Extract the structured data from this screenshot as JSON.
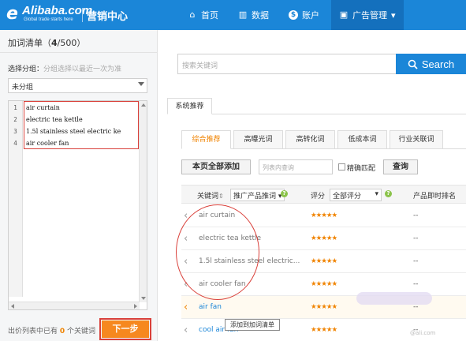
{
  "header": {
    "logo_mark": "e",
    "logo_text": "Alibaba.com",
    "logo_tagline": "Global trade starts here",
    "title": "营销中心",
    "nav": [
      {
        "label": "首页",
        "icon": "home-icon",
        "glyph": "⌂"
      },
      {
        "label": "数据",
        "icon": "bar-chart-icon",
        "glyph": "▥"
      },
      {
        "label": "账户",
        "icon": "dollar-circle-icon",
        "glyph": "$"
      },
      {
        "label": "广告管理",
        "icon": "briefcase-icon",
        "glyph": "▣",
        "caret": "▾"
      }
    ]
  },
  "left_panel": {
    "title_prefix": "加词清单（",
    "count": "4",
    "title_suffix": "/500）",
    "group_label": "选择分组：",
    "group_hint": "分组选择以最近一次为准",
    "group_value": "未分组",
    "lines": [
      "1",
      "2",
      "3",
      "4"
    ],
    "keywords": [
      "air curtain",
      "electric tea kettle",
      "1.5l stainless steel electric ke",
      "air cooler fan"
    ],
    "count_prefix": "出价列表中已有",
    "count_value": "0",
    "count_suffix": "个关键词",
    "next_button": "下一步"
  },
  "right_panel": {
    "search_placeholder": "搜索关键词",
    "search_button": "Search",
    "tab_label": "系统推荐",
    "subtabs": [
      "综合推荐",
      "高曝光词",
      "高转化词",
      "低成本词",
      "行业关联词"
    ],
    "add_all_button": "本页全部添加",
    "inner_search_placeholder": "列表内查询",
    "exact_label": "精确匹配",
    "query_button": "查询",
    "table": {
      "col_keyword": "关键词",
      "sort_glyph": "⇕",
      "col_promo": "推广产品推词",
      "col_score": "评分",
      "score_filter": "全部评分",
      "col_rank": "产品即时排名",
      "rows": [
        {
          "keyword": "air curtain",
          "stars": "★★★★★",
          "rank": "--"
        },
        {
          "keyword": "electric tea kettle",
          "stars": "★★★★★",
          "rank": "--"
        },
        {
          "keyword": "1.5l stainless steel electric...",
          "stars": "★★★★★",
          "rank": "--"
        },
        {
          "keyword": "air cooler fan",
          "stars": "★★★★★",
          "rank": "--"
        },
        {
          "keyword": "air fan",
          "stars": "★★★★★",
          "rank": "--"
        },
        {
          "keyword": "cool air fan",
          "stars": "★★★★★",
          "rank": "--"
        }
      ]
    },
    "tooltip": "添加到加词清单",
    "watermark": "@ali.com"
  },
  "colors": {
    "brand_blue": "#1b86d8",
    "accent_orange": "#f6881f",
    "highlight_red": "#d9403a"
  }
}
